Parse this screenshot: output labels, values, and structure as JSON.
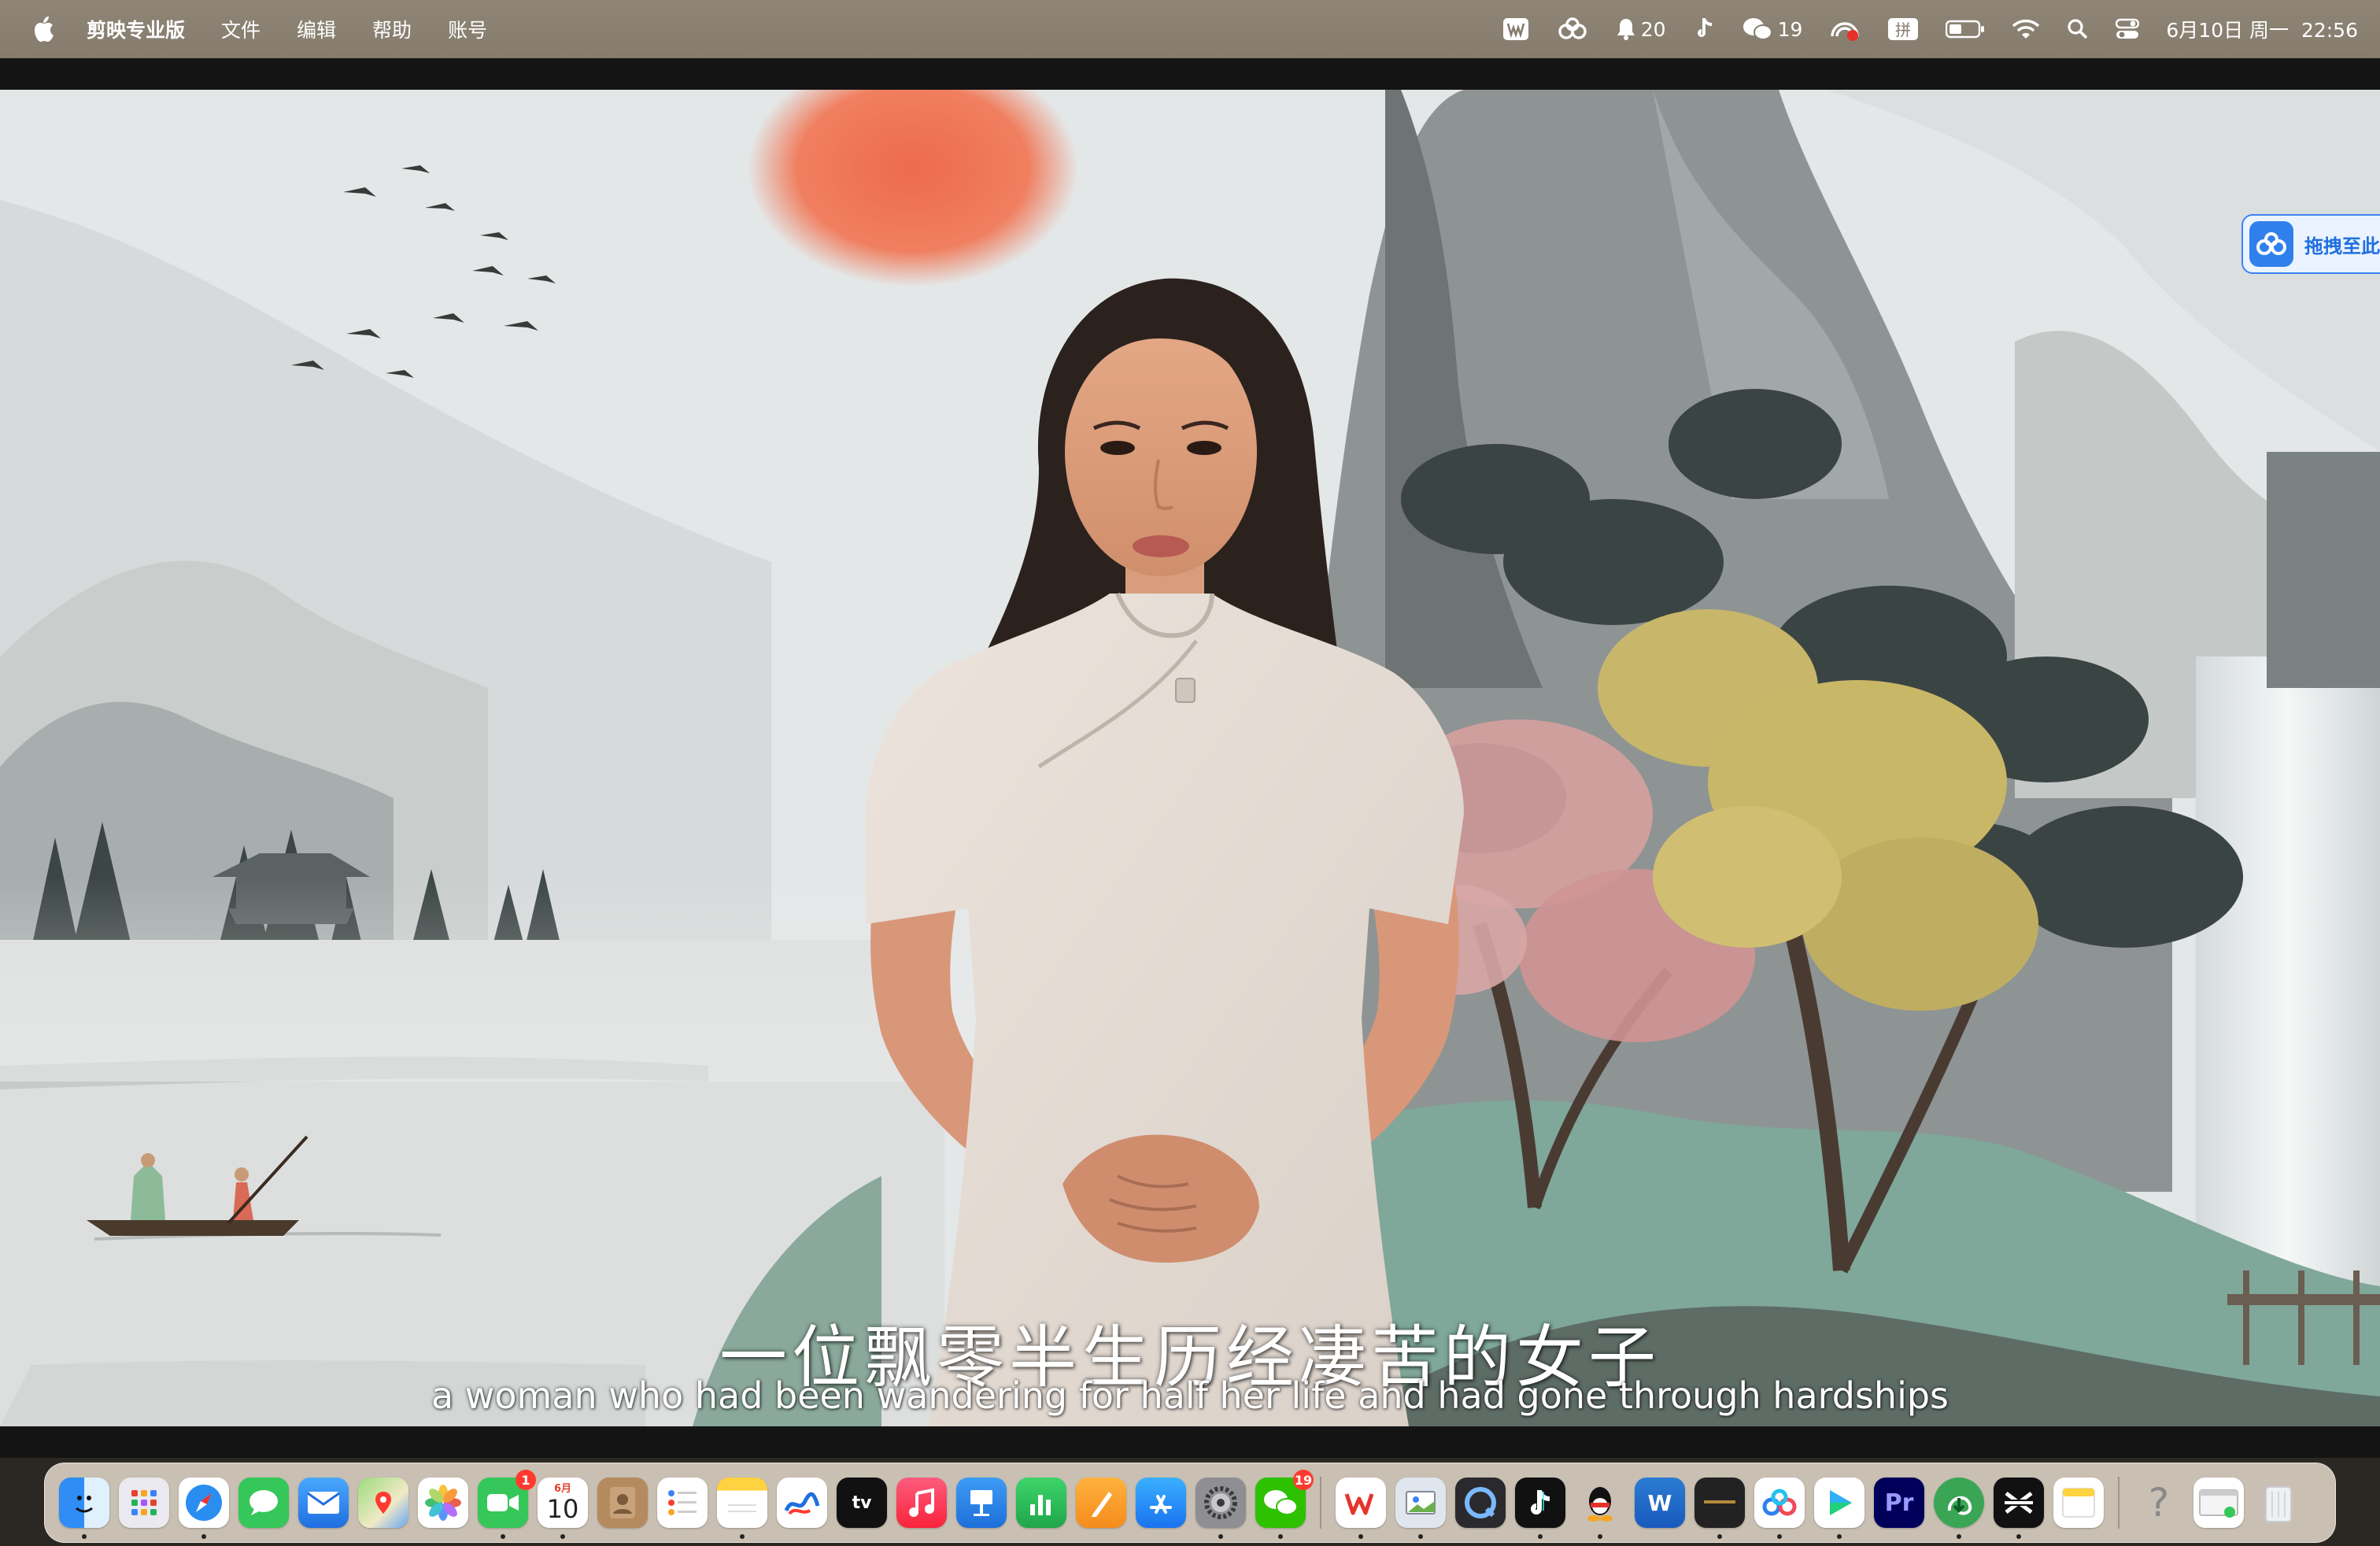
{
  "menubar": {
    "app_name": "剪映专业版",
    "menus": [
      "文件",
      "编辑",
      "帮助",
      "账号"
    ],
    "status": {
      "notification_count": "20",
      "wechat_count": "19",
      "input_method": "拼",
      "datetime": "6月10日 周一  22:56"
    }
  },
  "video": {
    "subtitle_zh": "一位飘零半生历经凄苦的女子",
    "subtitle_en": "a woman who had been wandering for half her life and had gone through hardships"
  },
  "drag_panel": {
    "label": "拖拽至此"
  },
  "dock": {
    "calendar_month": "6月",
    "calendar_day": "10",
    "facetime_badge": "1",
    "wechat_badge": "19",
    "appletv_label": "tv",
    "premiere_label": "Pr",
    "word_label": "W",
    "help_glyph": "?"
  },
  "colors": {
    "menubar": "#8a8172",
    "dock": "#d7cdc0",
    "accent_blue": "#2f80ed",
    "sun": "#ee6a4d"
  }
}
